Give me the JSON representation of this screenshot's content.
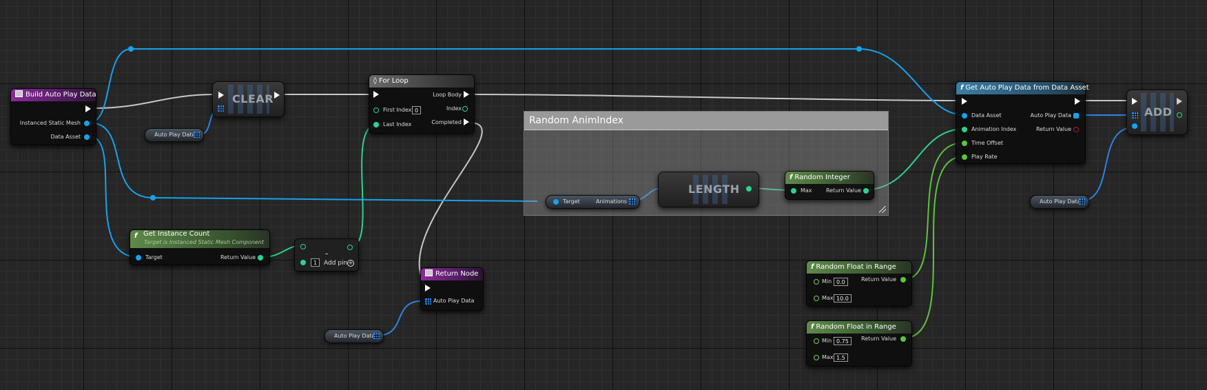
{
  "colors": {
    "exec_wire": "#c8c8c8",
    "object_wire": "#16a2ee",
    "int_wire": "#2dd38f",
    "float_wire": "#5ec43e",
    "struct_wire": "#2d84e6",
    "function_header": "#3d7ea3",
    "event_header": "#8c2a9c",
    "pure_header": "#5e8a4a"
  },
  "nodes": {
    "build_auto_play_data": {
      "title": "Build Auto Play Data",
      "pins": {
        "instanced_static_mesh": "Instanced Static Mesh",
        "data_asset": "Data Asset"
      }
    },
    "clear": {
      "title": "CLEAR"
    },
    "auto_play_data_var_1": {
      "label": "Auto Play Data"
    },
    "for_loop": {
      "title": "For Loop",
      "pins": {
        "first_index": "First Index",
        "first_index_value": "0",
        "last_index": "Last Index",
        "loop_body": "Loop Body",
        "index": "Index",
        "completed": "Completed"
      }
    },
    "comment": {
      "title": "Random AnimIndex"
    },
    "animations_getter": {
      "target": "Target",
      "animations": "Animations"
    },
    "length": {
      "title": "LENGTH"
    },
    "random_integer": {
      "title": "Random Integer",
      "max": "Max",
      "return_value": "Return Value"
    },
    "get_instance_count": {
      "title": "Get Instance Count",
      "subtitle": "Target is Instanced Static Mesh Component",
      "target": "Target",
      "return_value": "Return Value"
    },
    "subtract": {
      "symbol": "-",
      "value": "1",
      "add_pin": "Add pin"
    },
    "return_node": {
      "title": "Return Node",
      "auto_play_data": "Auto Play Data"
    },
    "auto_play_data_var_2": {
      "label": "Auto Play Data"
    },
    "get_auto_play_data": {
      "title": "Get Auto Play Data from Data Asset",
      "pins": {
        "data_asset": "Data Asset",
        "animation_index": "Animation Index",
        "time_offset": "Time Offset",
        "play_rate": "Play Rate",
        "auto_play_data": "Auto Play Data",
        "return_value": "Return Value"
      }
    },
    "add": {
      "title": "ADD"
    },
    "auto_play_data_var_3": {
      "label": "Auto Play Data"
    },
    "random_float_1": {
      "title": "Random Float in Range",
      "min": "Min",
      "min_value": "0.0",
      "max": "Max",
      "max_value": "10.0",
      "return_value": "Return Value"
    },
    "random_float_2": {
      "title": "Random Float in Range",
      "min": "Min",
      "min_value": "0.75",
      "max": "Max",
      "max_value": "1.5",
      "return_value": "Return Value"
    }
  }
}
